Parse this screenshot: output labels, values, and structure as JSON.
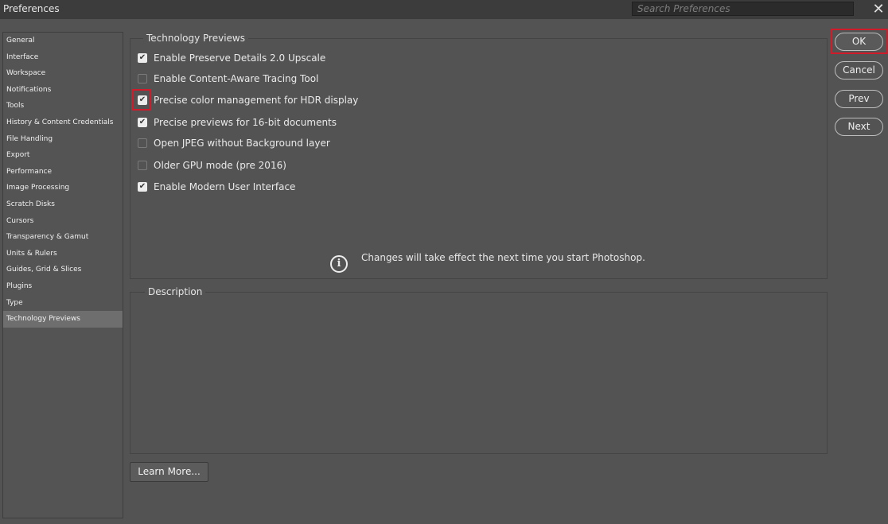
{
  "window": {
    "title": "Preferences",
    "close_glyph": "✕"
  },
  "search": {
    "placeholder": "Search Preferences"
  },
  "sidebar": {
    "items": [
      {
        "label": "General"
      },
      {
        "label": "Interface"
      },
      {
        "label": "Workspace"
      },
      {
        "label": "Notifications"
      },
      {
        "label": "Tools"
      },
      {
        "label": "History & Content Credentials"
      },
      {
        "label": "File Handling"
      },
      {
        "label": "Export"
      },
      {
        "label": "Performance"
      },
      {
        "label": "Image Processing"
      },
      {
        "label": "Scratch Disks"
      },
      {
        "label": "Cursors"
      },
      {
        "label": "Transparency & Gamut"
      },
      {
        "label": "Units & Rulers"
      },
      {
        "label": "Guides, Grid & Slices"
      },
      {
        "label": "Plugins"
      },
      {
        "label": "Type"
      },
      {
        "label": "Technology Previews",
        "selected": true
      }
    ]
  },
  "tech_previews": {
    "legend": "Technology Previews",
    "options": [
      {
        "label": "Enable Preserve Details 2.0 Upscale",
        "checked": true
      },
      {
        "label": "Enable Content-Aware Tracing Tool",
        "checked": false
      },
      {
        "label": "Precise color management for HDR display",
        "checked": true
      },
      {
        "label": "Precise previews for 16-bit documents",
        "checked": true
      },
      {
        "label": "Open JPEG without Background layer",
        "checked": false
      },
      {
        "label": "Older GPU mode (pre 2016)",
        "checked": false
      },
      {
        "label": "Enable Modern User Interface",
        "checked": true
      }
    ],
    "info_icon": "info-icon",
    "info_text": "Changes will take effect the next time you start Photoshop."
  },
  "description": {
    "legend": "Description"
  },
  "buttons": {
    "learn_more": "Learn More...",
    "ok": "OK",
    "cancel": "Cancel",
    "prev": "Prev",
    "next": "Next"
  },
  "colors": {
    "background": "#535353",
    "titlebar": "#3c3c3c",
    "highlight": "#d11a2a",
    "selected_item": "#6e6e6e"
  }
}
